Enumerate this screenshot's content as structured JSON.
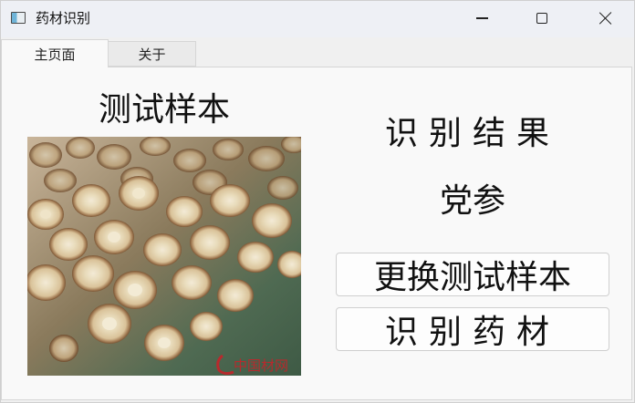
{
  "window": {
    "title": "药材识别",
    "icon": "app-window-icon"
  },
  "tabs": [
    {
      "label": "主页面",
      "active": true
    },
    {
      "label": "关于",
      "active": false
    }
  ],
  "main": {
    "sample_title": "测试样本",
    "sample_image_description": "herbal-slices-photo",
    "result_title": "识别结果",
    "result_value": "党参",
    "change_sample_button": "更换测试样本",
    "identify_button": "识别药材"
  },
  "colors": {
    "title_bar": "#eef0f5",
    "panel_bg": "#f9f9f9",
    "text": "#111111"
  }
}
